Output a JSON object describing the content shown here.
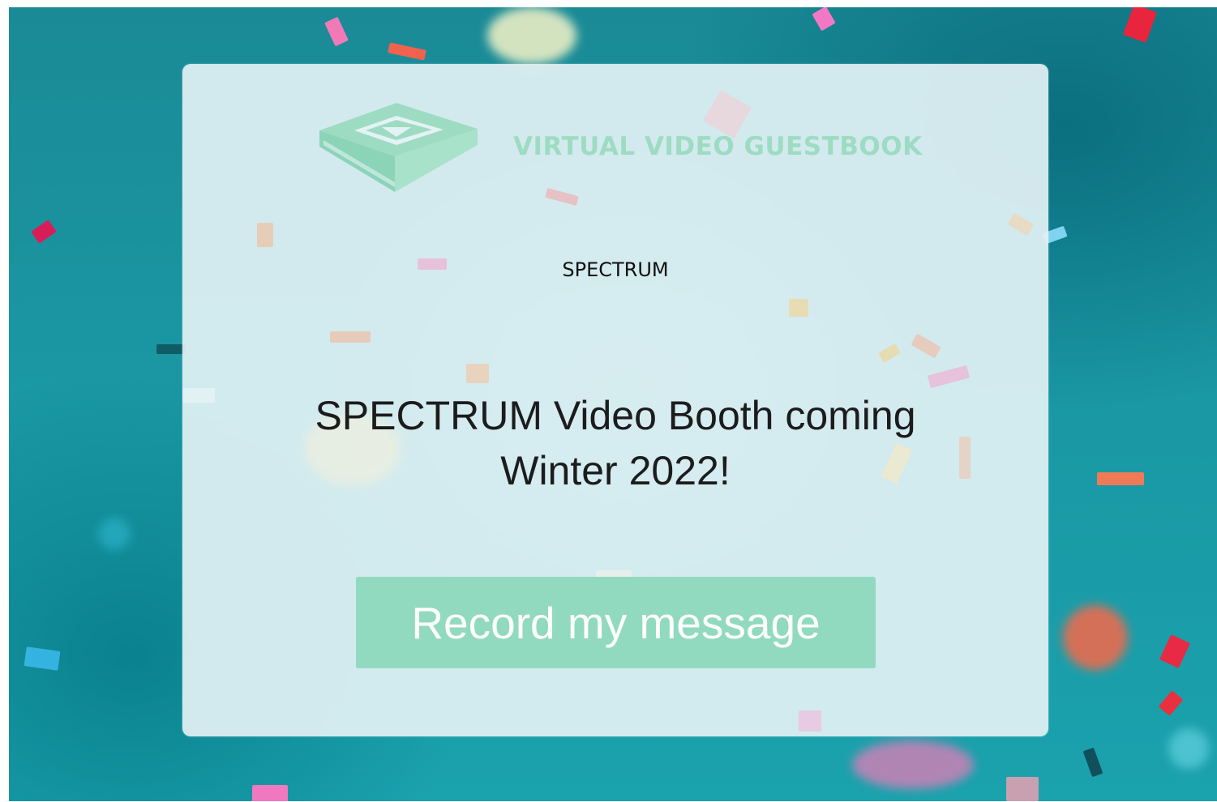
{
  "brand": {
    "name": "VIRTUAL VIDEO GUESTBOOK",
    "logo_icon": "guestbook-play-icon",
    "color": "#9ddcc2"
  },
  "event": {
    "organization": "SPECTRUM",
    "headline_line1": "SPECTRUM Video Booth coming",
    "headline_line2": "Winter 2022!"
  },
  "actions": {
    "record_label": "Record my message",
    "record_color": "#91dabf"
  },
  "background": {
    "style": "teal confetti",
    "base_color": "#1a97a3"
  }
}
